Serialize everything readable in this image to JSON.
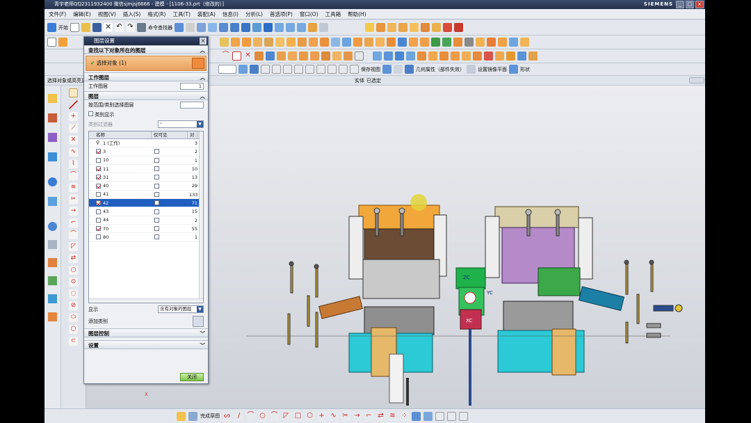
{
  "title": "青宇老师QQ2311932400 微信sjmjsj6666 - 建模 - [1106-33.prt（修改的）]",
  "brand": "SIEMENS",
  "menu": [
    "文件(F)",
    "编辑(E)",
    "视图(V)",
    "插入(S)",
    "格式(R)",
    "工具(T)",
    "装配(A)",
    "信息(I)",
    "分析(L)",
    "首选项(P)",
    "窗口(O)",
    "工具箱",
    "帮助(H)"
  ],
  "toolbar": {
    "start_label": "开始",
    "command_finder": "命令查找器",
    "save_view": "保存视图",
    "geometry_property": "几何属性（部件失效）",
    "set_mirror_plane": "设置镜像平面",
    "shape": "形状"
  },
  "hint_text": "选择对象或高亮显示",
  "status": {
    "entity": "实体",
    "selected": "已选定"
  },
  "dialog": {
    "title": "图层设置",
    "find_section": "查找以下对象所在的图层",
    "select_object": "选择对象 (1)",
    "work_layer_section": "工作图层",
    "work_layer_label": "工作图层",
    "work_layer_value": "1",
    "layer_section": "图层",
    "select_by_category": "按范围/类别选择图层",
    "category_display": "类别显示",
    "category_filter": "类别过滤器",
    "category_filter_value": "*",
    "columns": [
      "名称",
      "仅可见",
      "对象数"
    ],
    "rows": [
      {
        "name": "1 (工作)",
        "checked": false,
        "visible_only": false,
        "count": "3",
        "work": true
      },
      {
        "name": "3",
        "checked": true,
        "visible_only": false,
        "count": "2"
      },
      {
        "name": "10",
        "checked": false,
        "visible_only": false,
        "count": "1"
      },
      {
        "name": "11",
        "checked": true,
        "visible_only": false,
        "count": "10"
      },
      {
        "name": "31",
        "checked": true,
        "visible_only": false,
        "count": "13"
      },
      {
        "name": "40",
        "checked": true,
        "visible_only": false,
        "count": "29"
      },
      {
        "name": "41",
        "checked": false,
        "visible_only": false,
        "count": "133"
      },
      {
        "name": "42",
        "checked": true,
        "visible_only": false,
        "count": "71",
        "selected": true
      },
      {
        "name": "43",
        "checked": false,
        "visible_only": false,
        "count": "15"
      },
      {
        "name": "44",
        "checked": false,
        "visible_only": false,
        "count": "2"
      },
      {
        "name": "70",
        "checked": true,
        "visible_only": false,
        "count": "55"
      },
      {
        "name": "80",
        "checked": false,
        "visible_only": false,
        "count": "1"
      }
    ],
    "display_label": "显示",
    "display_value": "含有对象的图层",
    "add_category": "添加类别",
    "layer_control": "图层控制",
    "settings": "设置",
    "close_button": "关闭"
  },
  "bottom": {
    "finish_sketch": "完成草图"
  },
  "colors": {
    "accent": "#1e5fbf",
    "dialog_title": "#26324c",
    "select_row": "#e8a25e",
    "model_cyan": "#1fc8d4"
  }
}
